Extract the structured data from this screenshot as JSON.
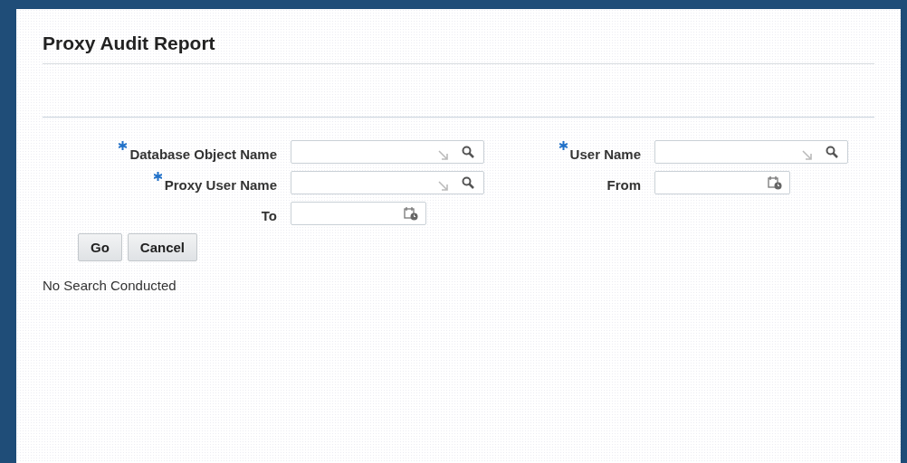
{
  "title": "Proxy Audit Report",
  "form": {
    "left": [
      {
        "label": "Database Object Name",
        "required": true,
        "kind": "lov"
      },
      {
        "label": "Proxy User Name",
        "required": true,
        "kind": "lov"
      },
      {
        "label": "To",
        "required": false,
        "kind": "date"
      }
    ],
    "right": [
      {
        "label": "User Name",
        "required": true,
        "kind": "lov"
      },
      {
        "label": "From",
        "required": false,
        "kind": "date"
      }
    ]
  },
  "buttons": [
    "Go",
    "Cancel"
  ],
  "status": "No Search Conducted"
}
